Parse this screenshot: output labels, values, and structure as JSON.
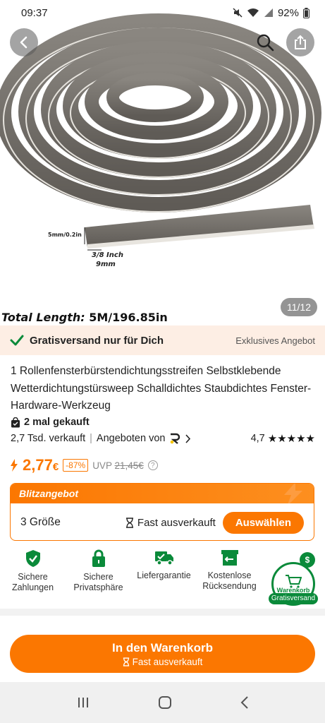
{
  "status_bar": {
    "time": "09:37",
    "battery": "92%"
  },
  "gallery": {
    "counter": "11/12",
    "dim_thickness": "5mm/0.2in",
    "dim_width_inch": "3/8 Inch",
    "dim_width_mm": "9mm",
    "total_length_label": "Total Length:",
    "total_length_value": "5M/196.85in"
  },
  "shipping": {
    "free_label": "Gratisversand nur für Dich",
    "exclusive_label": "Exklusives Angebot"
  },
  "product": {
    "title": "1 Rollenfensterbürstendichtungsstreifen Selbstklebende Wetterdichtungstürsweep Schalldichtes Staubdichtes Fenster-Hardware-Werkzeug",
    "bought": "2 mal gekauft",
    "sold": "2,7 Tsd. verkauft",
    "offered_by": "Angeboten von",
    "rating": "4,7",
    "stars": "★★★★★",
    "price_main": "2,77",
    "price_currency": "€",
    "discount": "-87%",
    "uvp_label": "UVP",
    "uvp_price": "21,45€"
  },
  "flash_deal": {
    "title": "Blitzangebot",
    "size_label": "3 Größe",
    "sold_out": "Fast ausverkauft",
    "choose_button": "Auswählen"
  },
  "guarantees": [
    {
      "label": "Sichere Zahlungen",
      "icon": "shield-check-icon"
    },
    {
      "label": "Sichere Privatsphäre",
      "icon": "lock-icon"
    },
    {
      "label": "Liefergarantie",
      "icon": "truck-check-icon"
    },
    {
      "label": "Kostenlose Rücksendung",
      "icon": "return-box-icon"
    }
  ],
  "cart_float": {
    "label": "Warenkorb",
    "badge": "Gratisversand"
  },
  "add_to_cart": {
    "label": "In den Warenkorb",
    "sublabel": "Fast ausverkauft"
  },
  "colors": {
    "accent": "#fb7701",
    "green": "#0a8a3a",
    "banner_bg": "#fdeee4"
  }
}
